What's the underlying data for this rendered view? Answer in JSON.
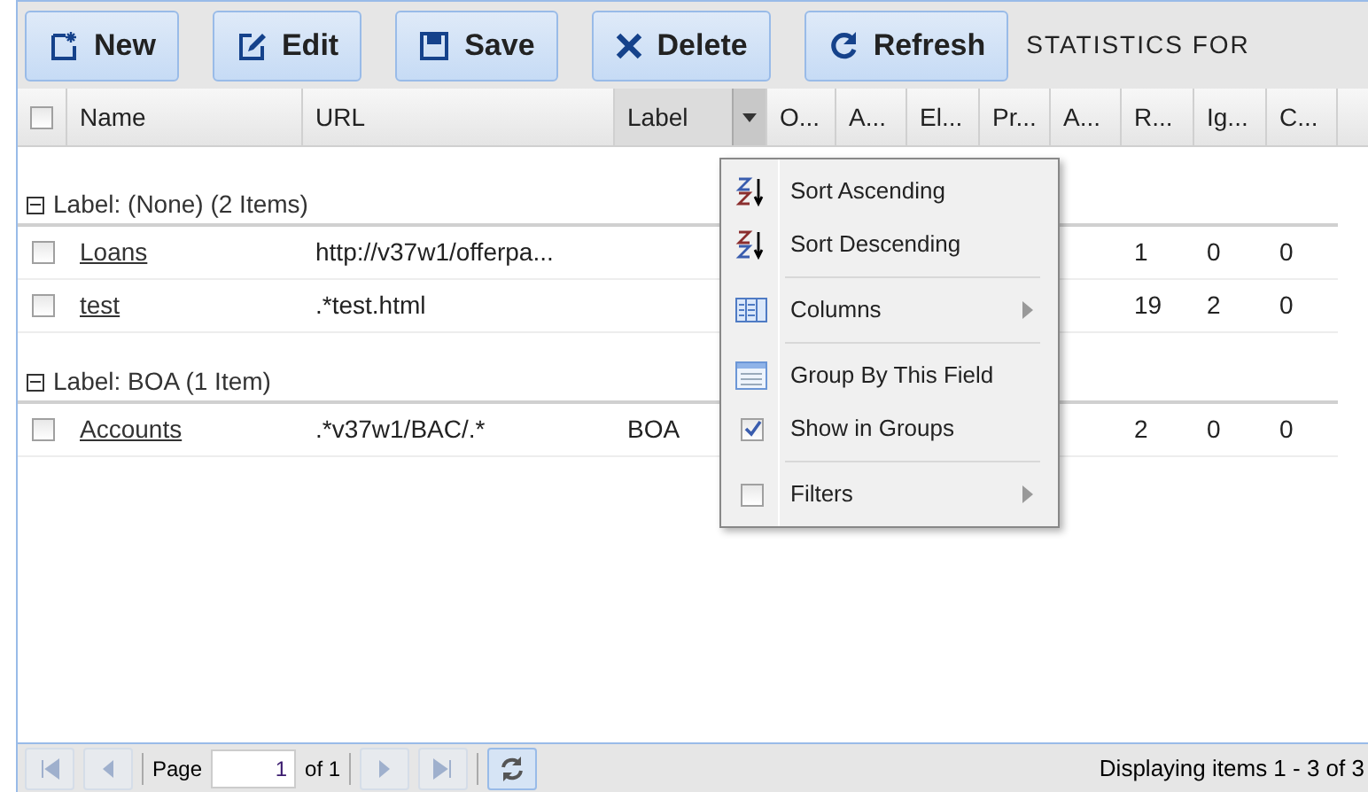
{
  "toolbar": {
    "buttons": [
      {
        "label": "New"
      },
      {
        "label": "Edit"
      },
      {
        "label": "Save"
      },
      {
        "label": "Delete"
      },
      {
        "label": "Refresh"
      }
    ],
    "title": "STATISTICS FOR"
  },
  "header": {
    "select_all": false,
    "columns": [
      {
        "label": "Name",
        "menu_open": false
      },
      {
        "label": "URL",
        "menu_open": false
      },
      {
        "label": "Label",
        "menu_open": true
      },
      {
        "label": "O...",
        "menu_open": false
      },
      {
        "label": "A...",
        "menu_open": false
      },
      {
        "label": "El...",
        "menu_open": false
      },
      {
        "label": "Pr...",
        "menu_open": false
      },
      {
        "label": "A...",
        "menu_open": false
      },
      {
        "label": "R...",
        "menu_open": false
      },
      {
        "label": "Ig...",
        "menu_open": false
      },
      {
        "label": "C...",
        "menu_open": false
      }
    ]
  },
  "groups": [
    {
      "title": "Label: (None) (2 Items)",
      "expanded": true,
      "rows": [
        {
          "checked": false,
          "cells": [
            "Loans",
            "http://v37w1/offerpa...",
            "",
            "",
            "",
            "",
            "",
            "",
            "1",
            "0",
            "0"
          ]
        },
        {
          "checked": false,
          "cells": [
            "test",
            ".*test.html",
            "",
            "",
            "",
            "",
            "",
            "",
            "19",
            "2",
            "0"
          ]
        }
      ]
    },
    {
      "title": "Label: BOA (1 Item)",
      "expanded": true,
      "rows": [
        {
          "checked": false,
          "cells": [
            "Accounts",
            ".*v37w1/BAC/.*",
            "BOA",
            "",
            "",
            "",
            "",
            "",
            "2",
            "0",
            "0"
          ]
        }
      ]
    }
  ],
  "column_menu": {
    "items": [
      {
        "kind": "sort-asc",
        "label": "Sort Ascending"
      },
      {
        "kind": "sort-desc",
        "label": "Sort Descending"
      },
      {
        "kind": "columns",
        "label": "Columns"
      },
      {
        "kind": "group",
        "label": "Group By This Field"
      },
      {
        "kind": "check",
        "label": "Show in Groups",
        "checked": true
      },
      {
        "kind": "filters",
        "label": "Filters",
        "checked": false
      }
    ]
  },
  "pager": {
    "page_label": "Page",
    "page_value": "1",
    "of_label": "of 1",
    "first_disabled": true,
    "prev_disabled": true,
    "next_disabled": true,
    "last_disabled": true,
    "status": "Displaying items 1 - 3 of 3"
  }
}
